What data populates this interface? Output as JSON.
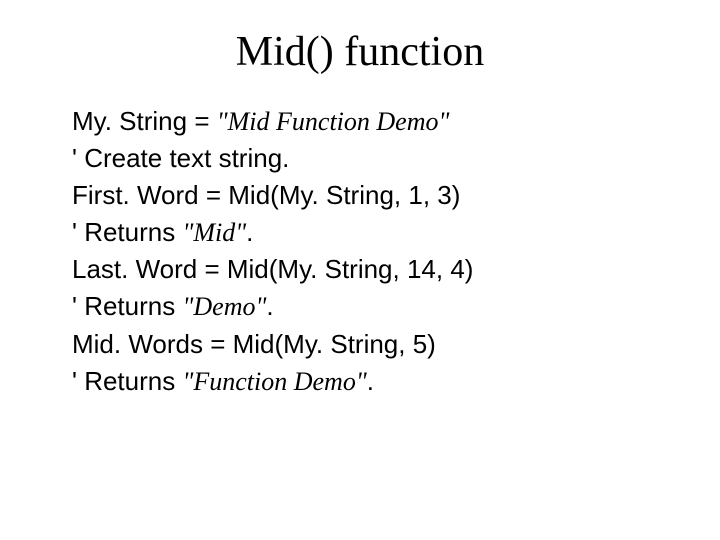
{
  "title": "Mid() function",
  "lines": {
    "l1a": "My. String = ",
    "l1b": "\"Mid Function Demo\"",
    "l2": "' Create text string.",
    "l3": "First. Word = Mid(My. String, 1, 3)",
    "l4a": "' Returns ",
    "l4b": "\"Mid\"",
    "l4c": ".",
    "l5": "Last. Word = Mid(My. String, 14, 4)",
    "l6a": "' Returns ",
    "l6b": "\"Demo\"",
    "l6c": ".",
    "l7": "Mid. Words = Mid(My. String, 5)",
    "l8a": "' Returns ",
    "l8b": "\"Function Demo\"",
    "l8c": "."
  }
}
